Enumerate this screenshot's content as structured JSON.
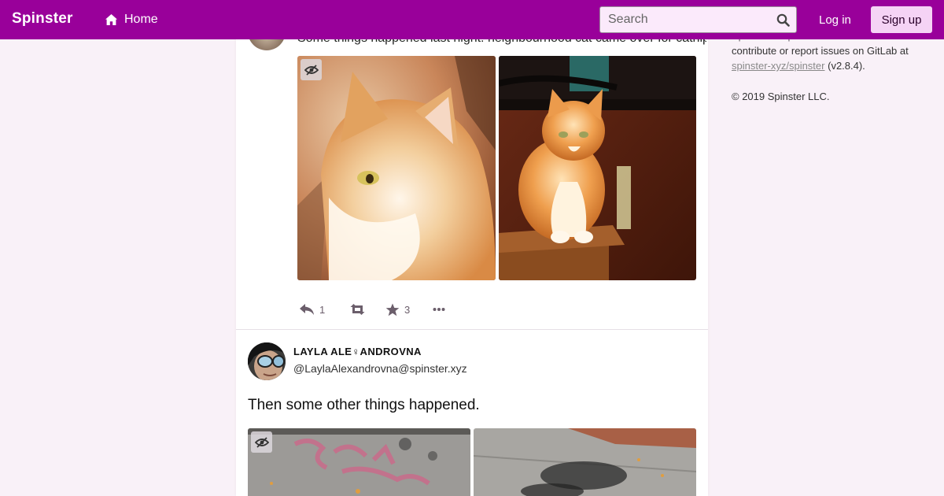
{
  "navbar": {
    "brand": "Spinster",
    "home_label": "Home",
    "search_placeholder": "Search",
    "login_label": "Log in",
    "signup_label": "Sign up",
    "colors": {
      "bar": "#99009a",
      "signup_bg": "#f5d3f5"
    }
  },
  "status_1": {
    "text": "Some things happened last night. neighbourhood cat came over for catnip.",
    "actions": {
      "replies": "1",
      "favourites": "3"
    },
    "media": [
      "cat-closeup-photo",
      "cat-on-box-photo"
    ]
  },
  "status_2": {
    "display_name": "LAYLA ALE♀ANDROVNA",
    "handle": "@LaylaAlexandrovna@spinster.xyz",
    "text": "Then some other things happened.",
    "media": [
      "sidewalk-graffiti-photo-1",
      "sidewalk-graffiti-photo-2"
    ]
  },
  "sidebar": {
    "about_line1": "Spinster is open source software. You can",
    "about_line2": "contribute or report issues on GitLab at",
    "repo_link": "spinster-xyz/spinster",
    "version": "(v2.8.4).",
    "copyright": "© 2019 Spinster LLC."
  }
}
